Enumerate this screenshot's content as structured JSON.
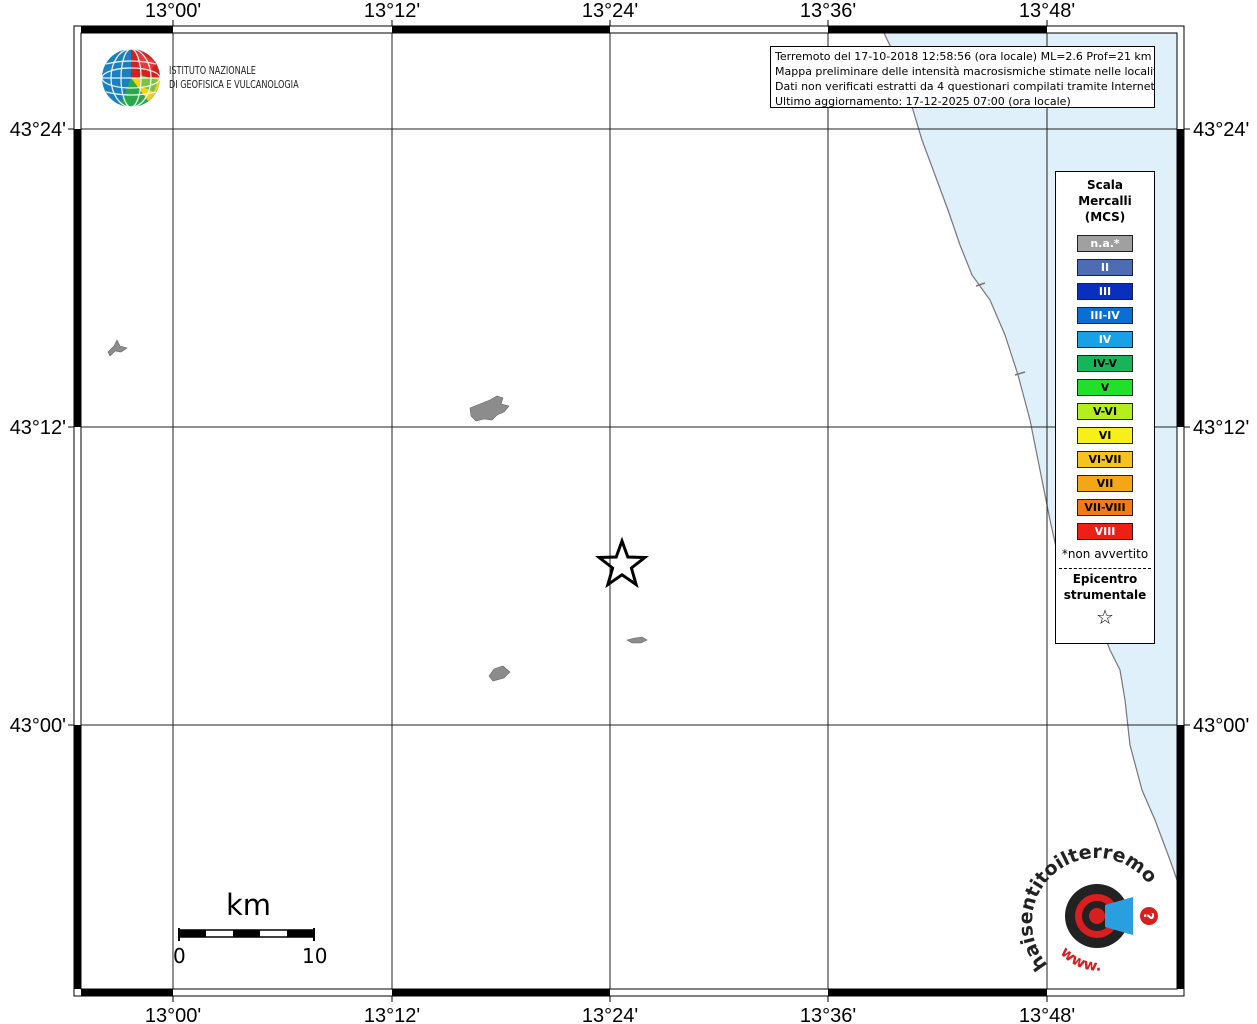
{
  "map": {
    "top_labels": [
      "13°00'",
      "13°12'",
      "13°24'",
      "13°36'",
      "13°48'"
    ],
    "bottom_labels": [
      "13°00'",
      "13°12'",
      "13°24'",
      "13°36'",
      "13°48'"
    ],
    "left_labels": [
      "43°24'",
      "43°12'",
      "43°00'"
    ],
    "right_labels": [
      "43°24'",
      "43°12'",
      "43°00'"
    ],
    "sea_color": "#dff0fb",
    "land_patch_color": "#8c8c8c"
  },
  "info": {
    "line1": "Terremoto del 17-10-2018 12:58:56 (ora locale) ML=2.6 Prof=21 km",
    "line2": "Mappa preliminare delle intensità macrosismiche stimate nelle località",
    "line3": "Dati non verificati estratti da 4 questionari compilati tramite Internet.",
    "line4": "Ultimo aggiornamento: 17-12-2025 07:00 (ora locale)"
  },
  "logo": {
    "line1": "ISTITUTO NAZIONALE",
    "line2": "DI GEOFISICA E VULCANOLOGIA"
  },
  "legend": {
    "title1": "Scala",
    "title2": "Mercalli",
    "title3": "(MCS)",
    "items": [
      {
        "label": "n.a.*",
        "bg": "#a0a0a0",
        "fg": "#ffffff"
      },
      {
        "label": "II",
        "bg": "#4e6bb5",
        "fg": "#ffffff"
      },
      {
        "label": "III",
        "bg": "#0a2fbf",
        "fg": "#ffffff"
      },
      {
        "label": "III-IV",
        "bg": "#0a6fd4",
        "fg": "#ffffff"
      },
      {
        "label": "IV",
        "bg": "#1aa0e6",
        "fg": "#ffffff"
      },
      {
        "label": "IV-V",
        "bg": "#19b35a",
        "fg": "#000000"
      },
      {
        "label": "V",
        "bg": "#22e02a",
        "fg": "#000000"
      },
      {
        "label": "V-VI",
        "bg": "#b4ee1e",
        "fg": "#000000"
      },
      {
        "label": "VI",
        "bg": "#f7ef1a",
        "fg": "#000000"
      },
      {
        "label": "VI-VII",
        "bg": "#f7c21c",
        "fg": "#000000"
      },
      {
        "label": "VII",
        "bg": "#f4a617",
        "fg": "#000000"
      },
      {
        "label": "VII-VIII",
        "bg": "#f47a16",
        "fg": "#000000"
      },
      {
        "label": "VIII",
        "bg": "#ee1f14",
        "fg": "#ffffff"
      }
    ],
    "note": "*non avvertito",
    "epi1": "Epicentro",
    "epi2": "strumentale",
    "epi_symbol": "☆"
  },
  "scalebar": {
    "unit": "km",
    "start": "0",
    "end": "10"
  },
  "hst": {
    "text": "haisentitoilterremoto.it",
    "www": "www."
  }
}
